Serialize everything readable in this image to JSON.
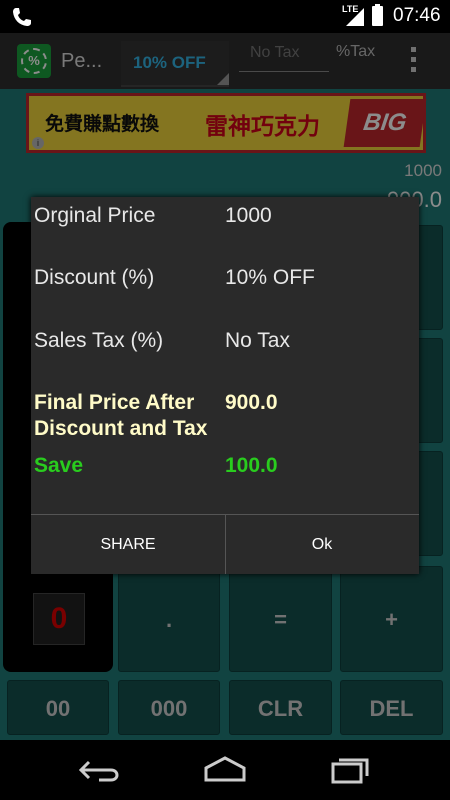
{
  "status_bar": {
    "time": "07:46",
    "network": "LTE",
    "icons": [
      "phone-icon",
      "signal-icon",
      "battery-icon"
    ]
  },
  "action_bar": {
    "app_title": "Pe...",
    "app_icon_symbol": "%",
    "discount_selected": "10% OFF",
    "tax_placeholder": "No Tax",
    "tax_suffix": "%Tax",
    "overflow_icon": "overflow-menu-icon"
  },
  "ad_banner": {
    "text_black": "免費賺點數換",
    "text_red": "雷神巧克力",
    "logo_text": "BIG",
    "info_icon": "info-icon"
  },
  "calculator": {
    "display_top": "1000",
    "display_bottom": "900.0",
    "keys_row_dot": [
      ".",
      "=",
      "+"
    ],
    "zero_key": "0",
    "keys_bottom": [
      "00",
      "000",
      "CLR",
      "DEL"
    ]
  },
  "dialog": {
    "rows": [
      {
        "label": "Orginal Price",
        "value": "1000"
      },
      {
        "label": "Discount (%)",
        "value": "10% OFF"
      },
      {
        "label": "Sales Tax (%)",
        "value": "No Tax"
      }
    ],
    "final": {
      "label_line1": "Final Price After",
      "label_line2": "Discount and Tax",
      "value": "900.0"
    },
    "save": {
      "label": "Save",
      "value": "100.0"
    },
    "buttons": {
      "share": "SHARE",
      "ok": "Ok"
    }
  },
  "colors": {
    "accent_blue": "#33b5e5",
    "save_green": "#29cc1e",
    "final_text": "#fffbc8",
    "background_teal": "#1f7a77"
  },
  "nav_bar": {
    "icons": [
      "back-icon",
      "home-icon",
      "recents-icon"
    ]
  }
}
